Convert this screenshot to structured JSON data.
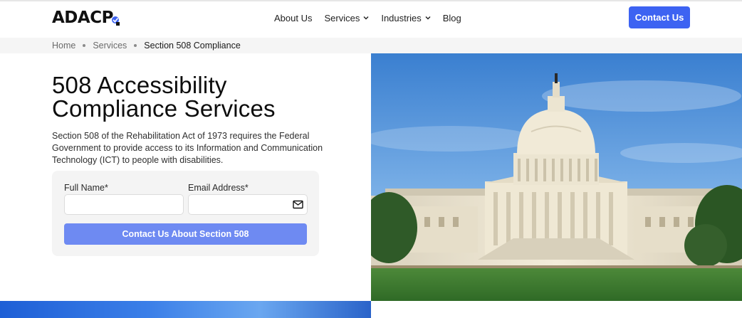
{
  "header": {
    "logo_text": "ADACP",
    "nav": [
      {
        "label": "About Us",
        "has_dropdown": false
      },
      {
        "label": "Services",
        "has_dropdown": true
      },
      {
        "label": "Industries",
        "has_dropdown": true
      },
      {
        "label": "Blog",
        "has_dropdown": false
      }
    ],
    "contact_label": "Contact Us"
  },
  "breadcrumb": {
    "items": [
      "Home",
      "Services"
    ],
    "current": "Section 508 Compliance"
  },
  "hero": {
    "title_line1": "508 Accessibility",
    "title_line2": "Compliance Services",
    "description": "Section 508 of the Rehabilitation Act of 1973 requires the Federal Government to provide access to its Information and Communication Technology (ICT) to people with disabilities."
  },
  "form": {
    "full_name_label": "Full Name*",
    "full_name_value": "",
    "email_label": "Email Address*",
    "email_value": "",
    "submit_label": "Contact Us About Section 508"
  },
  "colors": {
    "accent": "#3d63f2",
    "submit_button": "#6e8af2",
    "form_background": "#f4f4f4"
  },
  "icons": {
    "email_field": "envelope-icon",
    "dropdown": "chevron-down-icon"
  }
}
